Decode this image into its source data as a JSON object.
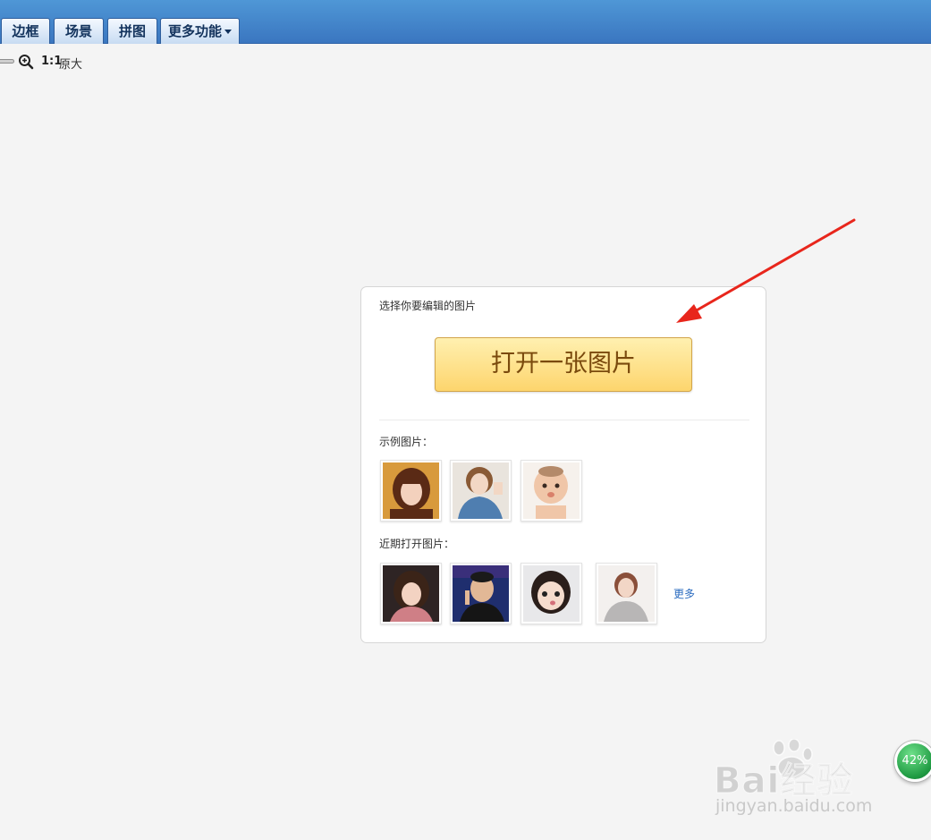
{
  "tabs": [
    {
      "label": "边框"
    },
    {
      "label": "场景"
    },
    {
      "label": "拼图"
    },
    {
      "label": "更多功能"
    }
  ],
  "zoom": {
    "ratio_label": "1:1",
    "original_label": "原大"
  },
  "panel": {
    "title": "选择你要编辑的图片",
    "open_button": "打开一张图片",
    "samples_label": "示例图片：",
    "recent_label": "近期打开图片：",
    "more_link": "更多"
  },
  "watermark": {
    "brand": "Bai经验",
    "site": "jingyan.baidu.com"
  },
  "progress_badge": {
    "label": "42%",
    "value": 0.42
  },
  "colors": {
    "accent_blue": "#3a76c0",
    "button_gold": "#fdd56d",
    "arrow_red": "#e8261c",
    "badge_green": "#1f9a42"
  }
}
